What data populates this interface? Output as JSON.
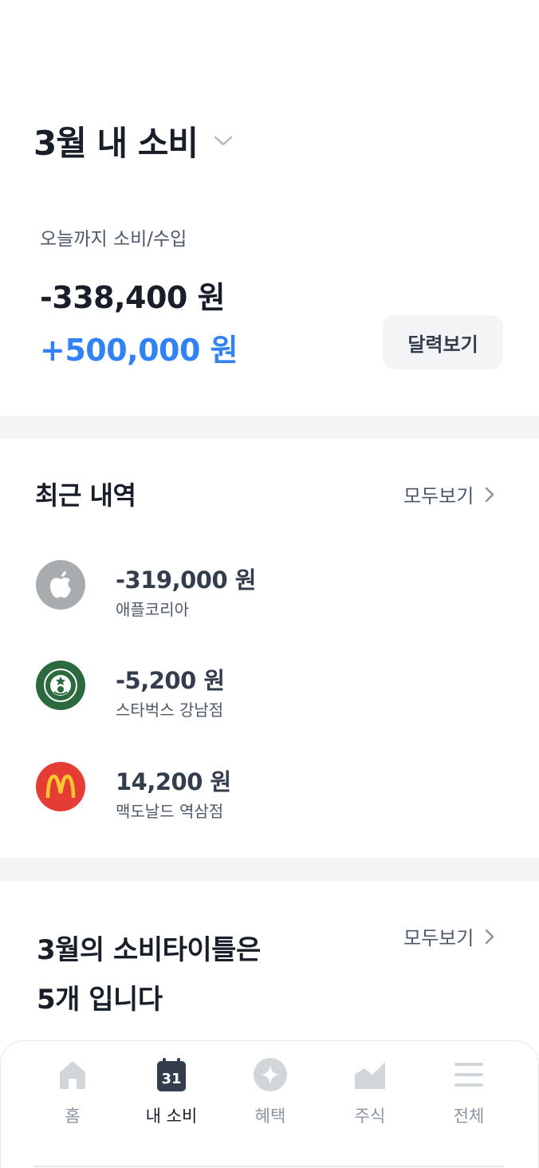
{
  "header": {
    "title": "3월 내 소비"
  },
  "summary": {
    "label": "오늘까지 소비/수입",
    "spend": "-338,400 원",
    "income": "+500,000 원",
    "calendar_button": "달력보기"
  },
  "recent": {
    "title": "최근 내역",
    "see_all": "모두보기",
    "items": [
      {
        "amount": "-319,000 원",
        "merchant": "애플코리아",
        "icon": "apple-logo-icon",
        "color": "#a9acaf"
      },
      {
        "amount": "-5,200 원",
        "merchant": "스타벅스 강남점",
        "icon": "starbucks-logo-icon",
        "color": "#2b6a3f"
      },
      {
        "amount": "14,200 원",
        "merchant": "맥도날드 역삼점",
        "icon": "mcdonalds-logo-icon",
        "color": "#e53d35"
      }
    ]
  },
  "titles": {
    "line1": "3월의 소비타이틀은",
    "line2": "5개 입니다",
    "see_all": "모두보기"
  },
  "nav": {
    "items": [
      {
        "label": "홈",
        "icon": "home-icon",
        "active": false
      },
      {
        "label": "내 소비",
        "icon": "calendar-icon",
        "badge": "31",
        "active": true
      },
      {
        "label": "혜택",
        "icon": "sparkle-icon",
        "active": false
      },
      {
        "label": "주식",
        "icon": "chart-icon",
        "active": false
      },
      {
        "label": "전체",
        "icon": "menu-icon",
        "active": false
      }
    ]
  },
  "colors": {
    "accent": "#3182f6",
    "divider": "#f2f4f6",
    "text_primary": "#191f28",
    "text_secondary": "#4e5968",
    "nav_inactive": "#8b95a1"
  }
}
